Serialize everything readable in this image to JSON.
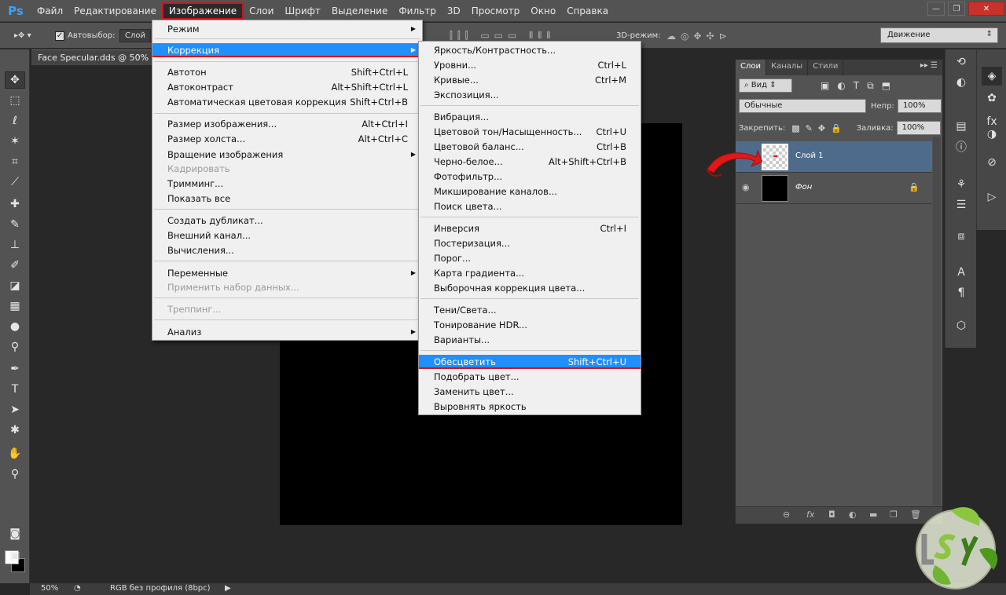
{
  "app": {
    "logo": "Ps"
  },
  "menubar": {
    "items": [
      "Файл",
      "Редактирование",
      "Изображение",
      "Слои",
      "Шрифт",
      "Выделение",
      "Фильтр",
      "3D",
      "Просмотр",
      "Окно",
      "Справка"
    ],
    "active_index": 2
  },
  "window_controls": {
    "minimize": "—",
    "maximize": "❐",
    "close": "✕"
  },
  "options_bar": {
    "auto_select_label": "Автовыбор:",
    "auto_select_value": "Слой",
    "three_d_mode_label": "3D-режим:",
    "mode_value": "Движение"
  },
  "document": {
    "tab_title": "Face Specular.dds @ 50% (C"
  },
  "image_menu": {
    "items": [
      {
        "label": "Режим",
        "shortcut": "",
        "submenu": true,
        "disabled": false
      },
      {
        "label": "Коррекция",
        "shortcut": "",
        "submenu": true,
        "disabled": false,
        "highlighted": true
      },
      {
        "label": "Автотон",
        "shortcut": "Shift+Ctrl+L",
        "submenu": false,
        "disabled": false
      },
      {
        "label": "Автоконтраст",
        "shortcut": "Alt+Shift+Ctrl+L",
        "submenu": false,
        "disabled": false
      },
      {
        "label": "Автоматическая цветовая коррекция",
        "shortcut": "Shift+Ctrl+B",
        "submenu": false,
        "disabled": false
      },
      {
        "label": "Размер изображения...",
        "shortcut": "Alt+Ctrl+I",
        "submenu": false,
        "disabled": false
      },
      {
        "label": "Размер холста...",
        "shortcut": "Alt+Ctrl+C",
        "submenu": false,
        "disabled": false
      },
      {
        "label": "Вращение изображения",
        "shortcut": "",
        "submenu": true,
        "disabled": false
      },
      {
        "label": "Кадрировать",
        "shortcut": "",
        "submenu": false,
        "disabled": true
      },
      {
        "label": "Тримминг...",
        "shortcut": "",
        "submenu": false,
        "disabled": false
      },
      {
        "label": "Показать все",
        "shortcut": "",
        "submenu": false,
        "disabled": false
      },
      {
        "label": "Создать дубликат...",
        "shortcut": "",
        "submenu": false,
        "disabled": false
      },
      {
        "label": "Внешний канал...",
        "shortcut": "",
        "submenu": false,
        "disabled": false
      },
      {
        "label": "Вычисления...",
        "shortcut": "",
        "submenu": false,
        "disabled": false
      },
      {
        "label": "Переменные",
        "shortcut": "",
        "submenu": true,
        "disabled": false
      },
      {
        "label": "Применить набор данных...",
        "shortcut": "",
        "submenu": false,
        "disabled": true
      },
      {
        "label": "Треппинг...",
        "shortcut": "",
        "submenu": false,
        "disabled": true
      },
      {
        "label": "Анализ",
        "shortcut": "",
        "submenu": true,
        "disabled": false
      }
    ]
  },
  "adjust_menu": {
    "items": [
      {
        "label": "Яркость/Контрастность...",
        "shortcut": ""
      },
      {
        "label": "Уровни...",
        "shortcut": "Ctrl+L"
      },
      {
        "label": "Кривые...",
        "shortcut": "Ctrl+M"
      },
      {
        "label": "Экспозиция...",
        "shortcut": ""
      },
      {
        "label": "Вибрация...",
        "shortcut": ""
      },
      {
        "label": "Цветовой тон/Насыщенность...",
        "shortcut": "Ctrl+U"
      },
      {
        "label": "Цветовой баланс...",
        "shortcut": "Ctrl+B"
      },
      {
        "label": "Черно-белое...",
        "shortcut": "Alt+Shift+Ctrl+B"
      },
      {
        "label": "Фотофильтр...",
        "shortcut": ""
      },
      {
        "label": "Микширование каналов...",
        "shortcut": ""
      },
      {
        "label": "Поиск цвета...",
        "shortcut": ""
      },
      {
        "label": "Инверсия",
        "shortcut": "Ctrl+I"
      },
      {
        "label": "Постеризация...",
        "shortcut": ""
      },
      {
        "label": "Порог...",
        "shortcut": ""
      },
      {
        "label": "Карта градиента...",
        "shortcut": ""
      },
      {
        "label": "Выборочная коррекция цвета...",
        "shortcut": ""
      },
      {
        "label": "Тени/Света...",
        "shortcut": ""
      },
      {
        "label": "Тонирование HDR...",
        "shortcut": ""
      },
      {
        "label": "Варианты...",
        "shortcut": ""
      },
      {
        "label": "Обесцветить",
        "shortcut": "Shift+Ctrl+U",
        "highlighted": true
      },
      {
        "label": "Подобрать цвет...",
        "shortcut": ""
      },
      {
        "label": "Заменить цвет...",
        "shortcut": ""
      },
      {
        "label": "Выровнять яркость",
        "shortcut": ""
      }
    ]
  },
  "layers_panel": {
    "tabs": [
      "Слои",
      "Каналы",
      "Стили"
    ],
    "active_tab": 0,
    "filter_label": "Вид",
    "blend_mode": "Обычные",
    "opacity_label": "Непр:",
    "opacity_value": "100%",
    "lock_label": "Закрепить:",
    "fill_label": "Заливка:",
    "fill_value": "100%",
    "layers": [
      {
        "name": "Слой 1",
        "selected": true,
        "visible": false,
        "locked": false,
        "thumb": "transparent"
      },
      {
        "name": "Фон",
        "selected": false,
        "visible": true,
        "locked": true,
        "thumb": "black"
      }
    ]
  },
  "status_bar": {
    "zoom": "50%",
    "info": "RGB без профиля (8bpc)"
  },
  "colors": {
    "accent_highlight": "#1e90ff",
    "annotation_red": "#d0131b",
    "layer_selected": "#4f6b8c"
  }
}
